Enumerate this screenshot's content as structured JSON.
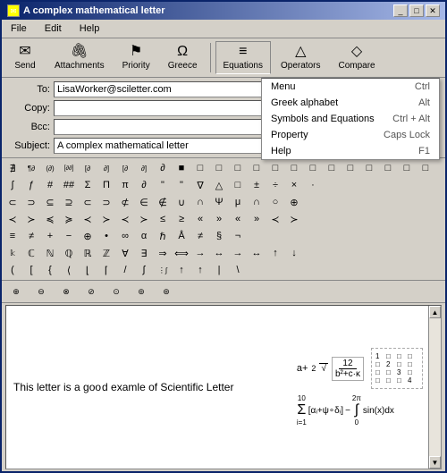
{
  "window": {
    "title": "A complex mathematical letter",
    "title_icon": "✉"
  },
  "title_controls": {
    "minimize": "_",
    "maximize": "□",
    "close": "✕"
  },
  "menu": {
    "items": [
      {
        "label": "File"
      },
      {
        "label": "Edit"
      },
      {
        "label": "Help"
      }
    ]
  },
  "toolbar": {
    "buttons": [
      {
        "id": "send",
        "icon": "✉",
        "label": "Send"
      },
      {
        "id": "attachments",
        "icon": "📎",
        "label": "Attachments"
      },
      {
        "id": "priority",
        "icon": "⚑",
        "label": "Priority"
      },
      {
        "id": "greece",
        "icon": "Ω",
        "label": "Greece"
      },
      {
        "id": "equations",
        "icon": "≡",
        "label": "Equations",
        "active": true
      },
      {
        "id": "operators",
        "icon": "△",
        "label": "Operators"
      },
      {
        "id": "compare",
        "icon": "◇",
        "label": "Compare"
      }
    ]
  },
  "form": {
    "to_label": "To:",
    "to_value": "LisaWorker@sciletter.com",
    "copy_label": "Copy:",
    "copy_value": "",
    "bcc_label": "Bcc:",
    "bcc_value": "",
    "subject_label": "Subject:",
    "subject_value": "A complex mathematical letter"
  },
  "dropdown": {
    "items": [
      {
        "label": "Menu",
        "shortcut": "Ctrl"
      },
      {
        "label": "Greek alphabet",
        "shortcut": "Alt"
      },
      {
        "label": "Symbols and Equations",
        "shortcut": "Ctrl + Alt"
      },
      {
        "label": "Property",
        "shortcut": "Caps Lock"
      },
      {
        "label": "Help",
        "shortcut": "F1"
      }
    ]
  },
  "symbols": {
    "rows": [
      [
        "∄",
        "¶∂",
        "(∂)",
        "[∂∂]",
        "[∂",
        "∂]",
        "[∂",
        "∂]",
        "∂",
        "■",
        "□",
        "□",
        "□",
        "□",
        "□",
        "□",
        "□",
        "□",
        "□",
        "□",
        "□",
        "□",
        "□"
      ],
      [
        "∫",
        "ƒ",
        "#",
        "##",
        "Σ",
        "Π",
        "π",
        "∂",
        "\"",
        "\"",
        "∇",
        "△",
        "□",
        "±",
        "÷",
        "×",
        "·"
      ],
      [
        "⊂",
        "⊃",
        "⊆",
        "⊇",
        "⊂",
        "⊃",
        "⊄",
        "∈",
        "∉",
        "∪",
        "∩",
        "Ψ",
        "μ",
        "∩",
        "○",
        "⊕"
      ],
      [
        "≺",
        "≻",
        "≼",
        "≽",
        "≺",
        "≻",
        "≺",
        "≻",
        "≤",
        "≥",
        "«",
        "»",
        "«",
        "»",
        "≺",
        "≻"
      ],
      [
        "≡",
        "≠",
        "+",
        "−",
        "⊕",
        "•",
        "∞",
        "α",
        "ℏ",
        "Å",
        "≠",
        "§",
        "¬"
      ],
      [
        "𝕜",
        "ℂ",
        "ℕ",
        "ℚ",
        "ℝ",
        "ℤ",
        "∀",
        "∃",
        "⇒",
        "⟺",
        "→",
        "↔",
        "→",
        "↔",
        "↑",
        "↓"
      ],
      [
        "(",
        "[",
        "{",
        "⟨",
        "⌊",
        "⌈",
        "/",
        "∫",
        "∫",
        "↑",
        "↑",
        "|",
        "\\"
      ]
    ]
  },
  "bottom_toolbar": {
    "buttons": [
      "⊕",
      "⊖",
      "⊗",
      "⊘",
      "⊙",
      "⊚",
      "⊛"
    ]
  },
  "content": {
    "text": "This letter is a good examle of Scientific Letter",
    "cursor_pos": "good|"
  },
  "math": {
    "expr1_parts": [
      "a+",
      "2",
      "√",
      "12",
      "b²+c·κ"
    ],
    "matrix": [
      [
        "1",
        "□",
        "□",
        "□"
      ],
      [
        "□",
        "2",
        "□",
        "□"
      ],
      [
        "□",
        "□",
        "3",
        "□"
      ],
      [
        "□",
        "□",
        "□",
        "4"
      ]
    ],
    "expr2": "∑[αᵢ+ψ∘δᵢ]",
    "expr2_from": "i=1",
    "expr2_to": "10",
    "expr3": "∫ sin(x)dx",
    "expr3_from": "0",
    "expr3_to": "2π"
  }
}
